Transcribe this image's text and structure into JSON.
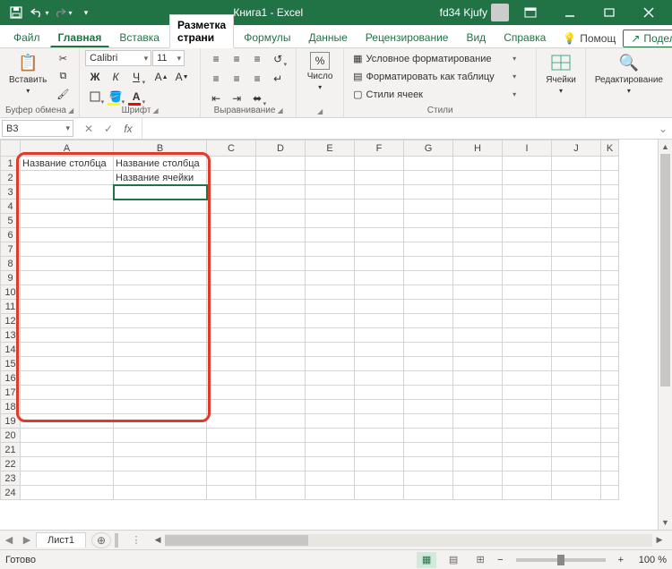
{
  "title": {
    "doc": "Книга1",
    "app": "Excel",
    "joined": "Книга1  -  Excel"
  },
  "user": {
    "name": "fd34 Kjufy"
  },
  "tabs": {
    "file": "Файл",
    "home": "Главная",
    "insert": "Вставка",
    "layout": "Разметка страни",
    "formulas": "Формулы",
    "data": "Данные",
    "review": "Рецензирование",
    "view": "Вид",
    "help": "Справка",
    "tellme": "Помощ",
    "share": "Поделиться"
  },
  "ribbon": {
    "clipboard": {
      "label": "Буфер обмена",
      "paste": "Вставить"
    },
    "font": {
      "label": "Шрифт",
      "name": "Calibri",
      "size": "11",
      "bold": "Ж",
      "italic": "К",
      "underline": "Ч"
    },
    "alignment": {
      "label": "Выравнивание"
    },
    "number": {
      "label": "Число",
      "btn": "Число"
    },
    "styles": {
      "label": "Стили",
      "cond": "Условное форматирование",
      "table": "Форматировать как таблицу",
      "cell": "Стили ячеек"
    },
    "cells": {
      "label": "Ячейки"
    },
    "editing": {
      "label": "Редактирование"
    }
  },
  "formula": {
    "namebox": "B3",
    "value": ""
  },
  "columns": [
    "A",
    "B",
    "C",
    "D",
    "E",
    "F",
    "G",
    "H",
    "I",
    "J",
    "K"
  ],
  "rows": [
    1,
    2,
    3,
    4,
    5,
    6,
    7,
    8,
    9,
    10,
    11,
    12,
    13,
    14,
    15,
    16,
    17,
    18,
    19,
    20,
    21,
    22,
    23,
    24
  ],
  "cells": {
    "a1": "Название столбца",
    "b1": "Название столбца",
    "b2": "Название ячейки"
  },
  "sheet": {
    "tab1": "Лист1"
  },
  "status": {
    "ready": "Готово",
    "zoom": "100 %",
    "minus": "−",
    "plus": "+"
  }
}
